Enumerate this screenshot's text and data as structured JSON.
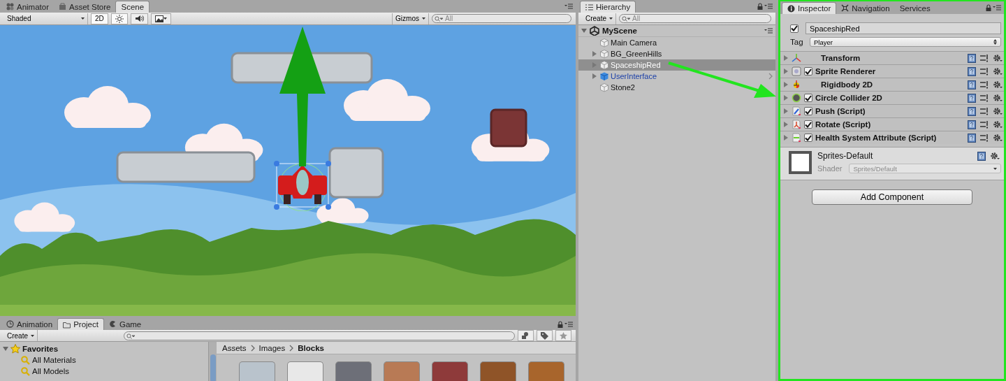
{
  "scene_panel": {
    "tabs": [
      {
        "label": "Animator",
        "selected": false,
        "kind": "animator"
      },
      {
        "label": "Asset Store",
        "selected": false,
        "kind": "store"
      },
      {
        "label": "Scene",
        "selected": true,
        "kind": "none"
      }
    ],
    "shading": "Shaded",
    "mode_2d": {
      "label": "2D",
      "on": true
    },
    "lighting": {
      "on": true
    },
    "audio": {
      "on": false
    },
    "gizmos": "Gizmos",
    "search": {
      "placeholder": "All"
    }
  },
  "bottom_panel": {
    "tabs": [
      {
        "label": "Animation",
        "selected": false,
        "kind": "clock"
      },
      {
        "label": "Project",
        "selected": true,
        "kind": "folder"
      },
      {
        "label": "Game",
        "selected": false,
        "kind": "game"
      }
    ],
    "create": "Create",
    "favorites": {
      "label": "Favorites",
      "expanded": true,
      "children": [
        {
          "label": "All Materials"
        },
        {
          "label": "All Models"
        }
      ]
    },
    "breadcrumbs": [
      {
        "label": "Assets"
      },
      {
        "label": "Images"
      },
      {
        "label": "Blocks"
      }
    ],
    "assets": [
      {
        "color": "#b9c3cc"
      },
      {
        "color": "#e8e8e8"
      },
      {
        "color": "#6d6f78"
      },
      {
        "color": "#b87a55"
      },
      {
        "color": "#8e3a3a"
      },
      {
        "color": "#8f5428"
      },
      {
        "color": "#a8652c"
      }
    ]
  },
  "hierarchy": {
    "tab": "Hierarchy",
    "create": "Create",
    "search": {
      "placeholder": "All"
    },
    "scene": "MyScene",
    "items": [
      {
        "label": "Main Camera",
        "kind": "object",
        "has_children": false,
        "selected": false
      },
      {
        "label": "BG_GreenHills",
        "kind": "object",
        "has_children": true,
        "selected": false
      },
      {
        "label": "SpaceshipRed",
        "kind": "object",
        "has_children": true,
        "selected": true
      },
      {
        "label": "UserInterface",
        "kind": "prefab",
        "has_children": true,
        "selected": false
      },
      {
        "label": "Stone2",
        "kind": "object",
        "has_children": false,
        "selected": false
      }
    ]
  },
  "inspector": {
    "tabs": [
      {
        "label": "Inspector",
        "selected": true,
        "kind": "info"
      },
      {
        "label": "Navigation",
        "selected": false,
        "kind": "nav"
      },
      {
        "label": "Services",
        "selected": false,
        "kind": "none"
      }
    ],
    "active": true,
    "name": "SpaceshipRed",
    "tag_label": "Tag",
    "tag": "Player",
    "components": [
      {
        "name": "Transform",
        "kind": "transform"
      },
      {
        "name": "Sprite Renderer",
        "kind": "sprite",
        "checked": true
      },
      {
        "name": "Rigidbody 2D",
        "kind": "rigidbody"
      },
      {
        "name": "Circle Collider 2D",
        "kind": "collider",
        "checked": true
      },
      {
        "name": "Push (Script)",
        "kind": "script-blue",
        "checked": true
      },
      {
        "name": "Rotate (Script)",
        "kind": "script-red",
        "checked": true
      },
      {
        "name": "Health System Attribute (Script)",
        "kind": "script-green",
        "checked": true
      }
    ],
    "material": {
      "name": "Sprites-Default",
      "shader_label": "Shader",
      "shader": "Sprites/Default"
    },
    "add_component": "Add Component"
  }
}
